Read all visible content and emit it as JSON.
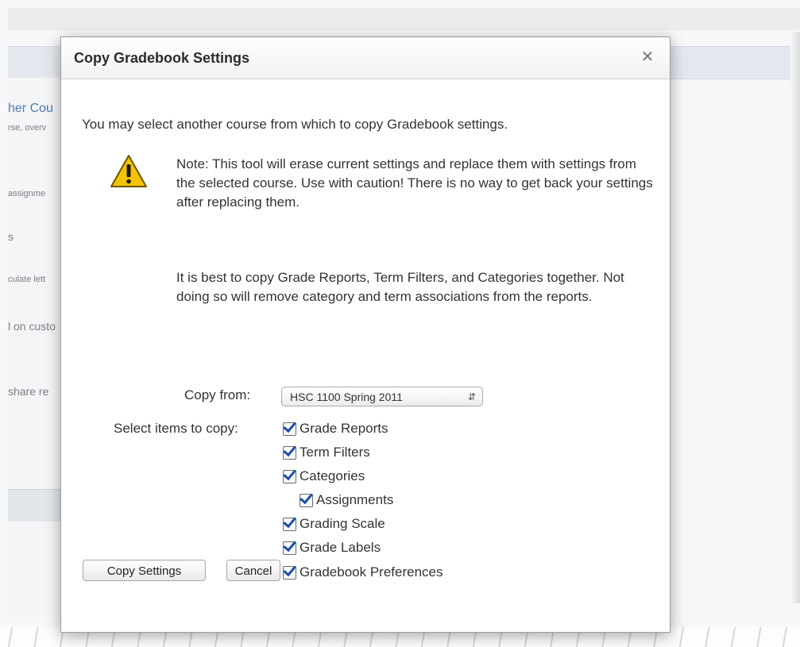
{
  "background": {
    "link_fragment": "her Cou",
    "lines": [
      "rse, overv",
      "assignme",
      "s",
      "culate lett",
      "l on custo",
      "share re"
    ]
  },
  "dialog": {
    "title": "Copy Gradebook Settings",
    "close_glyph": "✕",
    "intro": "You may select another course from which to copy Gradebook settings.",
    "warning_icon": "warning-triangle-icon",
    "note": "Note: This tool will erase current settings and replace them with settings from the selected course. Use with caution! There is no way to get back your settings after replacing them.",
    "advice": "It is best to copy Grade Reports, Term Filters, and Categories together. Not doing so will remove category and term associations from the reports.",
    "copy_from": {
      "label": "Copy from:",
      "selected": "HSC 1100 Spring 2011"
    },
    "items_label": "Select items to copy:",
    "items": [
      {
        "label": "Grade Reports",
        "checked": true
      },
      {
        "label": "Term Filters",
        "checked": true
      },
      {
        "label": "Categories",
        "checked": true
      },
      {
        "label": "Assignments",
        "checked": true
      },
      {
        "label": "Grading Scale",
        "checked": true
      },
      {
        "label": "Grade Labels",
        "checked": true
      },
      {
        "label": "Gradebook Preferences",
        "checked": true
      }
    ],
    "buttons": {
      "copy": "Copy Settings",
      "cancel": "Cancel"
    }
  },
  "colors": {
    "link": "#4f7db9",
    "checkmark": "#1b4fa0",
    "warning": "#f5c400"
  }
}
